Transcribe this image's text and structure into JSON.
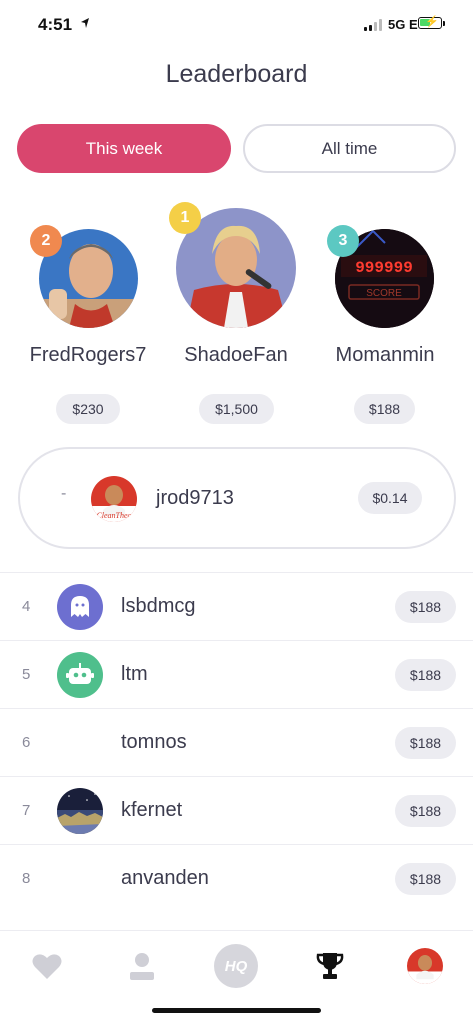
{
  "status_bar": {
    "time": "4:51",
    "network": "5G E"
  },
  "header": {
    "title": "Leaderboard"
  },
  "tabs": [
    {
      "label": "This week",
      "active": true
    },
    {
      "label": "All time",
      "active": false
    }
  ],
  "podium": [
    {
      "rank": "2",
      "name": "FredRogers7",
      "prize": "$230",
      "badge_color": "#f0894f"
    },
    {
      "rank": "1",
      "name": "ShadoeFan",
      "prize": "$1,500",
      "badge_color": "#f4cf47"
    },
    {
      "rank": "3",
      "name": "Momanmin",
      "prize": "$188",
      "badge_color": "#5cc8c2"
    }
  ],
  "podium_extra": {
    "score_digits": "999999",
    "score_label": "SCORE"
  },
  "current_user": {
    "rank": "-",
    "name": "jrod9713",
    "prize": "$0.14",
    "avatar_text": "CleanTheo"
  },
  "leaderboard": [
    {
      "rank": "4",
      "name": "lsbdmcg",
      "prize": "$188",
      "avatar": "ghost-icon"
    },
    {
      "rank": "5",
      "name": "ltm",
      "prize": "$188",
      "avatar": "robot-icon"
    },
    {
      "rank": "6",
      "name": "tomnos",
      "prize": "$188",
      "avatar": "none"
    },
    {
      "rank": "7",
      "name": "kfernet",
      "prize": "$188",
      "avatar": "photo"
    },
    {
      "rank": "8",
      "name": "anvanden",
      "prize": "$188",
      "avatar": "none"
    }
  ],
  "nav": {
    "items": [
      "heart-icon",
      "profile-icon",
      "hq-icon",
      "trophy-icon",
      "avatar"
    ],
    "hq_label": "HQ",
    "active": "trophy-icon"
  },
  "colors": {
    "accent": "#d9466e",
    "pill": "#ececf1",
    "text": "#3b3b4d"
  }
}
